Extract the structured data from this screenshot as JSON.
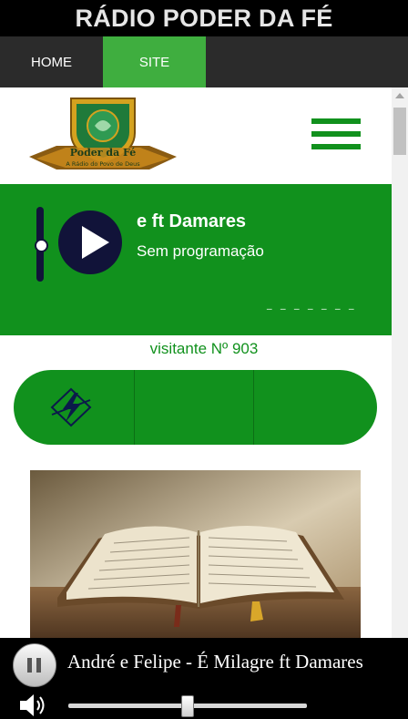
{
  "app": {
    "title": "RÁDIO PODER DA FÉ"
  },
  "nav": {
    "tabs": [
      {
        "label": "HOME"
      },
      {
        "label": "SITE"
      }
    ],
    "active": "SITE"
  },
  "logo": {
    "line1": "Poder da Fé",
    "line2": "A Rádio do Povo de Deus"
  },
  "player": {
    "song": "e ft Damares",
    "program": "Sem programação",
    "dashes": "_ _ _ _ _ _ _"
  },
  "visitor": {
    "text": "visitante Nº 903"
  },
  "bottom": {
    "now_playing": "André e Felipe - É Milagre ft Damares",
    "volume": 0.5
  },
  "colors": {
    "brand_green": "#11911d",
    "tab_active": "#3fae3f",
    "dark_navy": "#111339"
  },
  "icons": {
    "menu": "hamburger-icon",
    "play": "play-icon",
    "pause": "pause-icon",
    "volume": "speaker-icon",
    "link": "lightning-icon"
  }
}
